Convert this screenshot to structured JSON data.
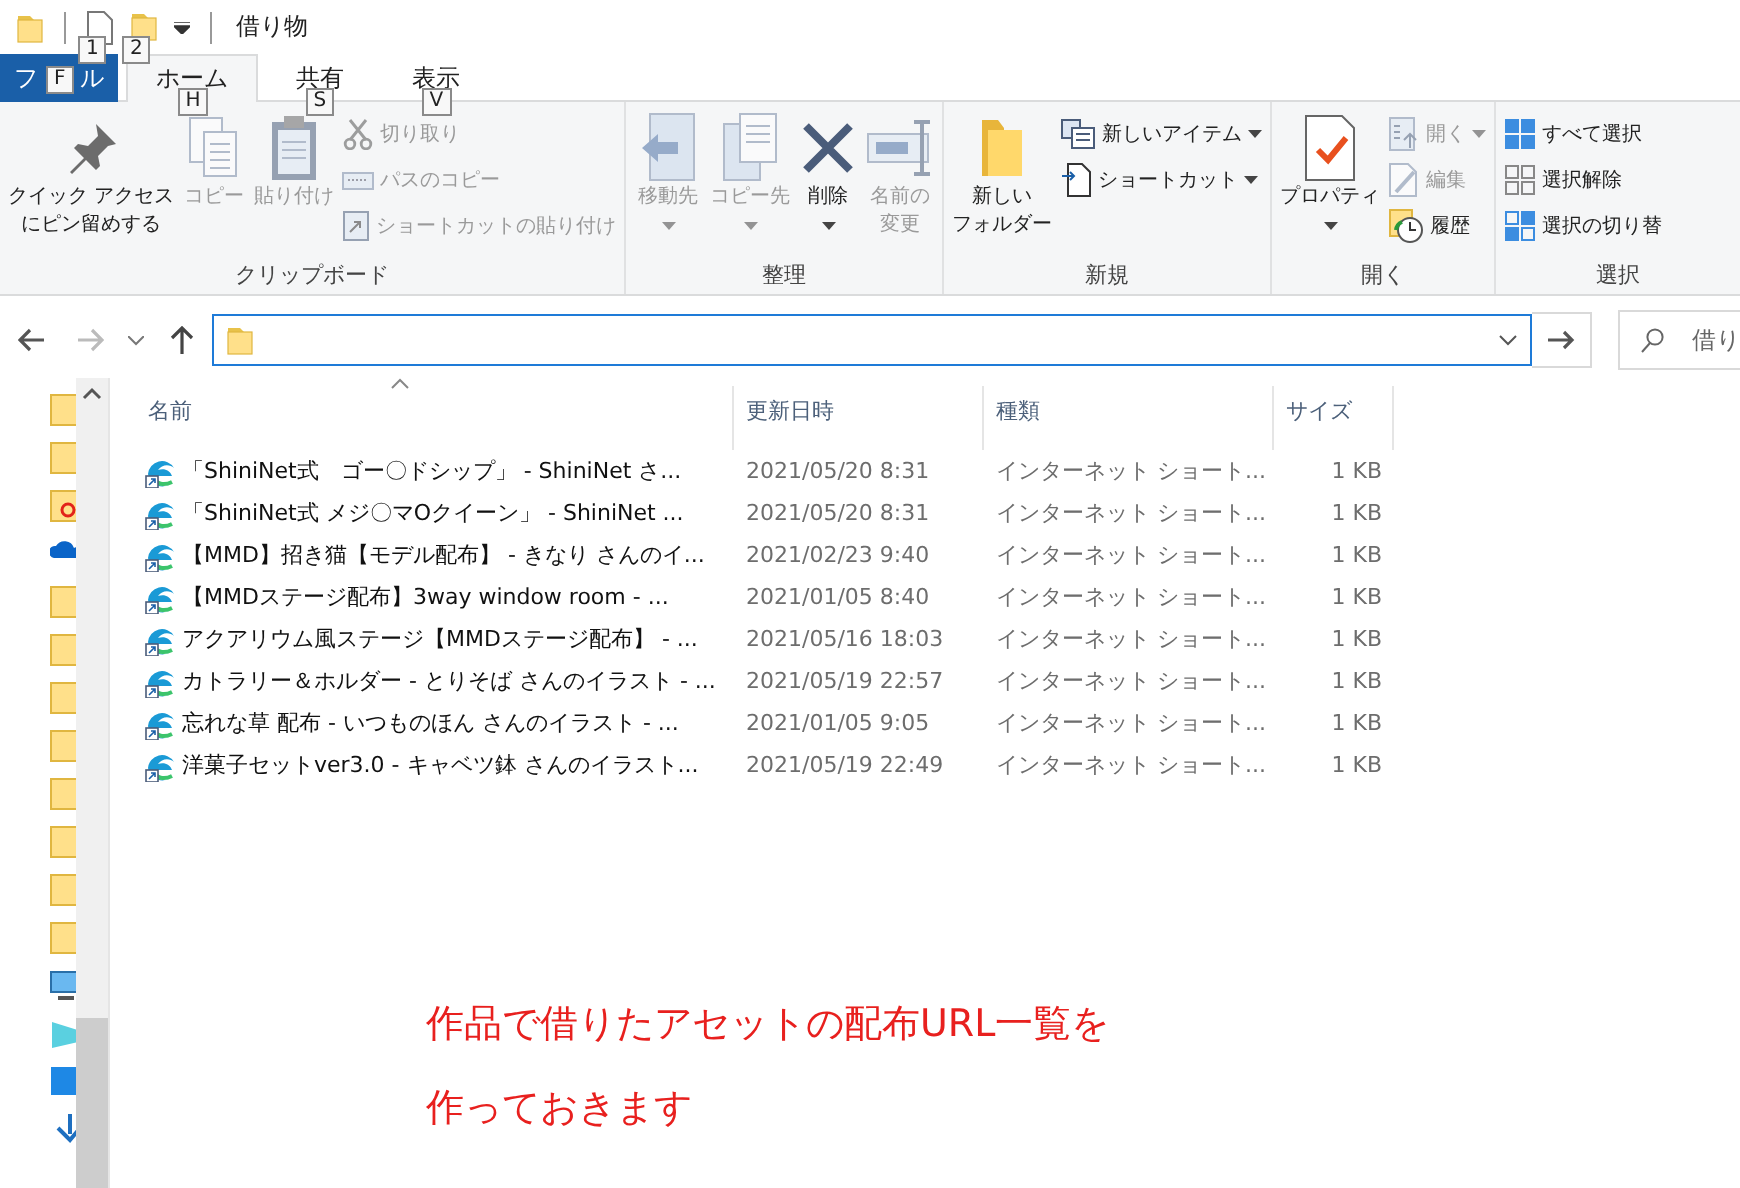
{
  "window": {
    "title": "借り物",
    "quick_access": [
      {
        "kind": "doc",
        "keytip": "1"
      },
      {
        "kind": "folder",
        "keytip": "2"
      }
    ]
  },
  "ribbon": {
    "tabs": [
      {
        "kind": "file",
        "label_parts": [
          "フ",
          "ル"
        ],
        "keytip": "F",
        "selected": false
      },
      {
        "kind": "tab",
        "label": "ホーム",
        "keytip": "H",
        "selected": true
      },
      {
        "kind": "tab",
        "label": "共有",
        "keytip": "S",
        "selected": false
      },
      {
        "kind": "tab",
        "label": "表示",
        "keytip": "V",
        "selected": false
      }
    ],
    "groups": [
      {
        "label": "クリップボード",
        "items": [
          {
            "kind": "pin",
            "lines": [
              "クイック アクセス",
              "にピン留めする"
            ],
            "disabled": false,
            "dropdown": false
          },
          {
            "kind": "copy",
            "lines": [
              "コピー"
            ],
            "disabled": true,
            "dropdown": false
          },
          {
            "kind": "paste",
            "lines": [
              "貼り付け"
            ],
            "disabled": true,
            "dropdown": false
          },
          {
            "kind": "stack",
            "items": [
              {
                "kind": "scissors",
                "label": "切り取り",
                "disabled": true,
                "dropdown": false
              },
              {
                "kind": "path",
                "label": "パスのコピー",
                "disabled": true,
                "dropdown": false
              },
              {
                "kind": "shortcut",
                "label": "ショートカットの貼り付け",
                "disabled": true,
                "dropdown": false
              }
            ]
          }
        ]
      },
      {
        "label": "整理",
        "items": [
          {
            "kind": "move",
            "lines": [
              "移動先"
            ],
            "disabled": true,
            "dropdown": true
          },
          {
            "kind": "copyto",
            "lines": [
              "コピー先"
            ],
            "disabled": true,
            "dropdown": true
          },
          {
            "kind": "delete",
            "lines": [
              "削除"
            ],
            "disabled": false,
            "dropdown": true
          },
          {
            "kind": "rename",
            "lines": [
              "名前の",
              "変更"
            ],
            "disabled": true,
            "dropdown": false
          }
        ]
      },
      {
        "label": "新規",
        "items": [
          {
            "kind": "folder",
            "lines": [
              "新しい",
              "フォルダー"
            ],
            "disabled": false,
            "dropdown": false
          },
          {
            "kind": "stack",
            "items": [
              {
                "kind": "newitem",
                "label": "新しいアイテム",
                "disabled": false,
                "dropdown": true
              },
              {
                "kind": "newshortcut",
                "label": "ショートカット",
                "disabled": false,
                "dropdown": true
              }
            ]
          }
        ]
      },
      {
        "label": "開く",
        "items": [
          {
            "kind": "properties",
            "lines": [
              "プロパティ"
            ],
            "disabled": false,
            "dropdown": true
          },
          {
            "kind": "stack",
            "items": [
              {
                "kind": "open",
                "label": "開く",
                "disabled": true,
                "dropdown": true
              },
              {
                "kind": "edit",
                "label": "編集",
                "disabled": true,
                "dropdown": false
              },
              {
                "kind": "history",
                "label": "履歴",
                "disabled": false,
                "dropdown": false
              }
            ]
          }
        ]
      },
      {
        "label": "選択",
        "items": [
          {
            "kind": "stack",
            "items": [
              {
                "kind": "selectall",
                "label": "すべて選択",
                "disabled": false,
                "dropdown": false
              },
              {
                "kind": "selectnone",
                "label": "選択解除",
                "disabled": false,
                "dropdown": false
              },
              {
                "kind": "invert",
                "label": "選択の切り替",
                "disabled": false,
                "dropdown": false
              }
            ]
          }
        ]
      }
    ]
  },
  "navigation": {
    "back_disabled": false,
    "forward_disabled": true,
    "search_placeholder": "借り"
  },
  "table": {
    "columns": [
      "名前",
      "更新日時",
      "種類",
      "サイズ"
    ],
    "rows": [
      {
        "name": "「ShiniNet式　ゴー〇ドシップ」 - ShiniNet さ...",
        "modified": "2021/05/20 8:31",
        "type": "インターネット ショート...",
        "size": "1 KB"
      },
      {
        "name": "「ShiniNet式 メジ〇マOクイーン」 - ShiniNet ...",
        "modified": "2021/05/20 8:31",
        "type": "インターネット ショート...",
        "size": "1 KB"
      },
      {
        "name": "【MMD】招き猫【モデル配布】 - きなり さんのイ...",
        "modified": "2021/02/23 9:40",
        "type": "インターネット ショート...",
        "size": "1 KB"
      },
      {
        "name": "【MMDステージ配布】3way window room - ...",
        "modified": "2021/01/05 8:40",
        "type": "インターネット ショート...",
        "size": "1 KB"
      },
      {
        "name": "アクアリウム風ステージ【MMDステージ配布】 - ...",
        "modified": "2021/05/16 18:03",
        "type": "インターネット ショート...",
        "size": "1 KB"
      },
      {
        "name": "カトラリー＆ホルダー - とりそば さんのイラスト - ...",
        "modified": "2021/05/19 22:57",
        "type": "インターネット ショート...",
        "size": "1 KB"
      },
      {
        "name": "忘れな草 配布 - いつものほん さんのイラスト - ...",
        "modified": "2021/01/05 9:05",
        "type": "インターネット ショート...",
        "size": "1 KB"
      },
      {
        "name": "洋菓子セットver3.0 - キャベツ鉢 さんのイラスト...",
        "modified": "2021/05/19 22:49",
        "type": "インターネット ショート...",
        "size": "1 KB"
      }
    ]
  },
  "annotation": [
    "作品で借りたアセットの配布URL一覧を",
    "作っておきます"
  ]
}
